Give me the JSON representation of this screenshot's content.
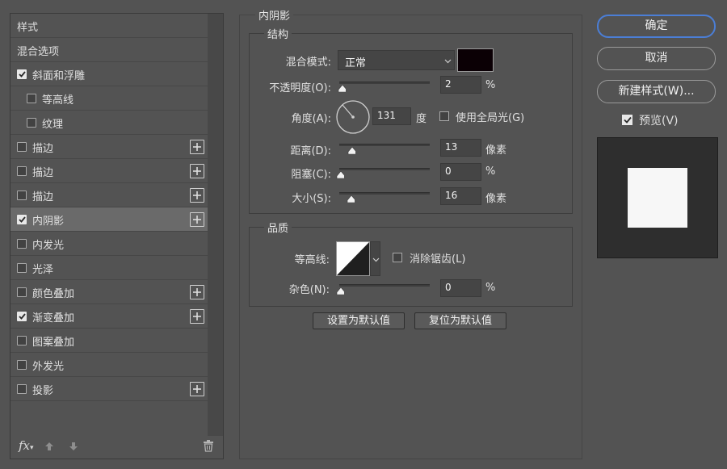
{
  "styles_list": {
    "header": "样式",
    "blend_options": "混合选项",
    "items": [
      {
        "label": "斜面和浮雕",
        "checked": true,
        "plus": false,
        "indent": false
      },
      {
        "label": "等高线",
        "checked": false,
        "plus": false,
        "indent": true
      },
      {
        "label": "纹理",
        "checked": false,
        "plus": false,
        "indent": true
      },
      {
        "label": "描边",
        "checked": false,
        "plus": true,
        "indent": false
      },
      {
        "label": "描边",
        "checked": false,
        "plus": true,
        "indent": false
      },
      {
        "label": "描边",
        "checked": false,
        "plus": true,
        "indent": false
      },
      {
        "label": "内阴影",
        "checked": true,
        "plus": true,
        "indent": false,
        "selected": true
      },
      {
        "label": "内发光",
        "checked": false,
        "plus": false,
        "indent": false
      },
      {
        "label": "光泽",
        "checked": false,
        "plus": false,
        "indent": false
      },
      {
        "label": "颜色叠加",
        "checked": false,
        "plus": true,
        "indent": false
      },
      {
        "label": "渐变叠加",
        "checked": true,
        "plus": true,
        "indent": false
      },
      {
        "label": "图案叠加",
        "checked": false,
        "plus": false,
        "indent": false
      },
      {
        "label": "外发光",
        "checked": false,
        "plus": false,
        "indent": false
      },
      {
        "label": "投影",
        "checked": false,
        "plus": true,
        "indent": false
      }
    ],
    "fx_label": "fx"
  },
  "inner_shadow": {
    "title": "内阴影",
    "structure": {
      "title": "结构",
      "blend_mode_label": "混合模式:",
      "blend_mode_value": "正常",
      "shadow_color": "#0b0005",
      "opacity_label": "不透明度(O):",
      "opacity_value": "2",
      "opacity_pct": 2,
      "opacity_unit": "%",
      "angle_label": "角度(A):",
      "angle_value": "131",
      "angle_unit": "度",
      "global_light_label": "使用全局光(G)",
      "global_light_checked": false,
      "distance_label": "距离(D):",
      "distance_value": "13",
      "distance_unit": "像素",
      "choke_label": "阻塞(C):",
      "choke_value": "0",
      "choke_unit": "%",
      "size_label": "大小(S):",
      "size_value": "16",
      "size_unit": "像素"
    },
    "quality": {
      "title": "品质",
      "contour_label": "等高线:",
      "anti_alias_label": "消除锯齿(L)",
      "anti_alias_checked": false,
      "noise_label": "杂色(N):",
      "noise_value": "0",
      "noise_unit": "%"
    },
    "make_default": "设置为默认值",
    "reset_default": "复位为默认值"
  },
  "right_buttons": {
    "ok": "确定",
    "cancel": "取消",
    "new_style": "新建样式(W)...",
    "preview_label": "预览(V)",
    "preview_checked": true
  },
  "colors": {
    "accent": "#4b7ed6",
    "preview_bg": "#2e2e2e",
    "preview_swatch": "#f7f7f7"
  }
}
